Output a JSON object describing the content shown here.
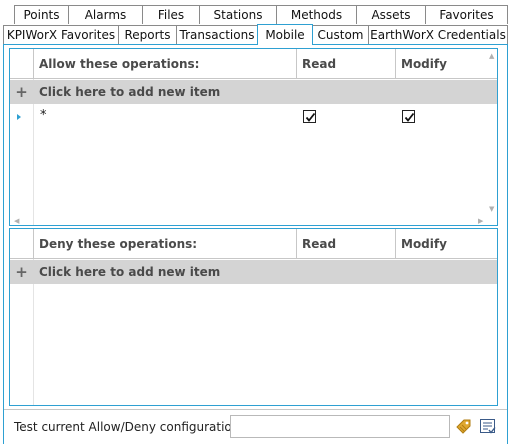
{
  "tabs_row1": [
    {
      "id": "points",
      "label": "Points"
    },
    {
      "id": "alarms",
      "label": "Alarms"
    },
    {
      "id": "files",
      "label": "Files"
    },
    {
      "id": "stations",
      "label": "Stations"
    },
    {
      "id": "methods",
      "label": "Methods"
    },
    {
      "id": "assets",
      "label": "Assets"
    },
    {
      "id": "favorites",
      "label": "Favorites"
    }
  ],
  "tabs_row2": [
    {
      "id": "kpiworx-favorites",
      "label": "KPIWorX Favorites"
    },
    {
      "id": "reports",
      "label": "Reports"
    },
    {
      "id": "transactions",
      "label": "Transactions"
    },
    {
      "id": "mobile",
      "label": "Mobile"
    },
    {
      "id": "custom",
      "label": "Custom"
    },
    {
      "id": "earthworx-credentials",
      "label": "EarthWorX Credentials"
    }
  ],
  "active_tab": "Mobile",
  "allow_grid": {
    "headers": {
      "operations": "Allow these operations:",
      "read": "Read",
      "modify": "Modify"
    },
    "add_row_label": "Click here to add new item",
    "rows": [
      {
        "operation": "*",
        "read": true,
        "modify": true
      }
    ]
  },
  "deny_grid": {
    "headers": {
      "operations": "Deny these operations:",
      "read": "Read",
      "modify": "Modify"
    },
    "add_row_label": "Click here to add new item",
    "rows": []
  },
  "test": {
    "label": "Test current Allow/Deny configuration:",
    "value": ""
  },
  "icons": {
    "test_run": "tag-icon",
    "test_result": "checklist-icon"
  },
  "colors": {
    "accent": "#2ea0d2",
    "add_row_bg": "#d4d4d4",
    "test_icon": "#e0a82e"
  }
}
